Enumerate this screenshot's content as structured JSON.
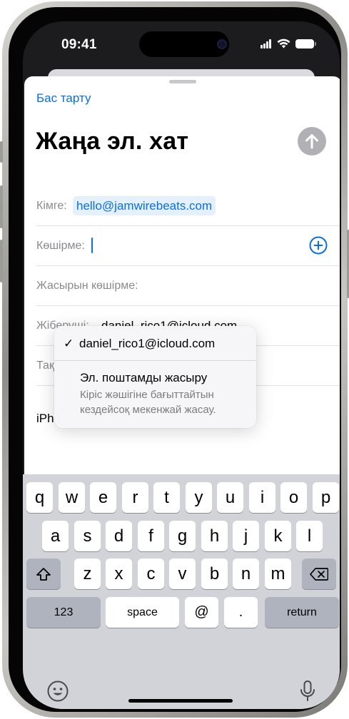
{
  "status_bar": {
    "time": "09:41"
  },
  "compose": {
    "cancel_label": "Бас тарту",
    "title": "Жаңа эл. хат",
    "to_label": "Кімге:",
    "to_value": "hello@jamwirebeats.com",
    "cc_label": "Көшірме:",
    "bcc_label": "Жасырын көшірме:",
    "from_label": "Жіберуші:",
    "from_value": "daniel_rico1@icloud.com",
    "subject_label_partial": "Тақ",
    "body_partial": "iPho"
  },
  "from_menu": {
    "selected_check": "✓",
    "option_selected": "daniel_rico1@icloud.com",
    "option_hide": "Эл. поштамды жасыру",
    "option_hide_description": "Кіріс жәшігіне бағыттайтын кездейсоқ мекенжай жасау."
  },
  "keyboard": {
    "row1": [
      "q",
      "w",
      "e",
      "r",
      "t",
      "y",
      "u",
      "i",
      "o",
      "p"
    ],
    "row2": [
      "a",
      "s",
      "d",
      "f",
      "g",
      "h",
      "j",
      "k",
      "l"
    ],
    "row3": [
      "z",
      "x",
      "c",
      "v",
      "b",
      "n",
      "m"
    ],
    "numbers_label": "123",
    "space_label": "space",
    "at_label": "@",
    "period_label": ".",
    "return_label": "return"
  },
  "colors": {
    "accent": "#0A6FE0",
    "send_disabled": "#B0B0B5",
    "keyboard_bg": "#D1D3D9"
  }
}
